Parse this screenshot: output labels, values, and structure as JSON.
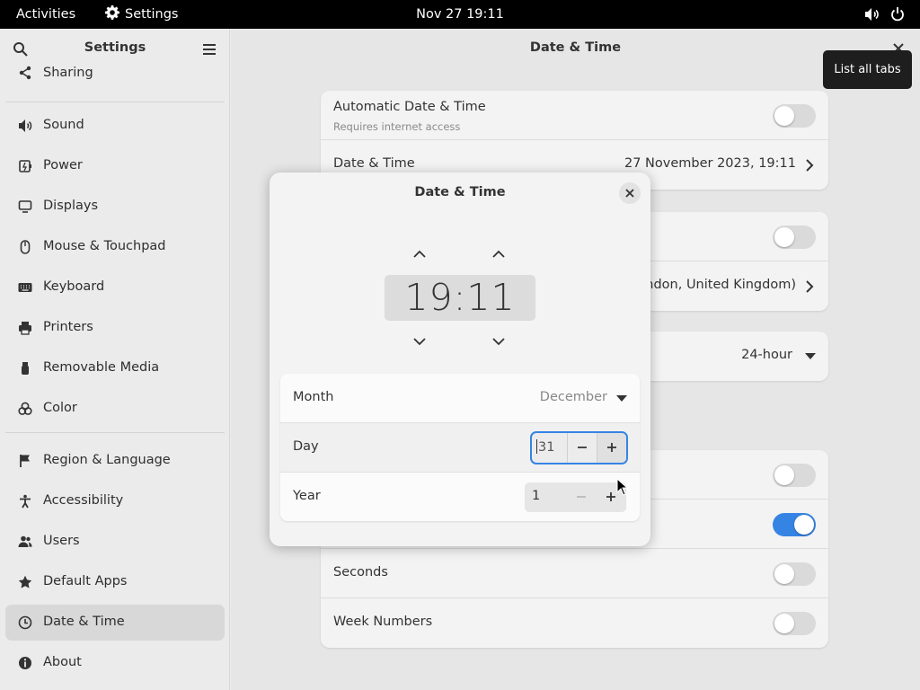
{
  "topbar": {
    "activities": "Activities",
    "app_name": "Settings",
    "clock": "Nov 27  19:11"
  },
  "sidebar": {
    "title": "Settings",
    "items": [
      {
        "label": "Sharing",
        "icon": "share-icon"
      },
      {
        "label": "Sound",
        "icon": "speaker-icon"
      },
      {
        "label": "Power",
        "icon": "battery-icon"
      },
      {
        "label": "Displays",
        "icon": "display-icon"
      },
      {
        "label": "Mouse & Touchpad",
        "icon": "mouse-icon"
      },
      {
        "label": "Keyboard",
        "icon": "keyboard-icon"
      },
      {
        "label": "Printers",
        "icon": "printer-icon"
      },
      {
        "label": "Removable Media",
        "icon": "usb-icon"
      },
      {
        "label": "Color",
        "icon": "color-icon"
      },
      {
        "label": "Region & Language",
        "icon": "flag-icon"
      },
      {
        "label": "Accessibility",
        "icon": "accessibility-icon"
      },
      {
        "label": "Users",
        "icon": "users-icon"
      },
      {
        "label": "Default Apps",
        "icon": "star-icon"
      },
      {
        "label": "Date & Time",
        "icon": "clock-icon",
        "active": true
      },
      {
        "label": "About",
        "icon": "info-icon"
      }
    ]
  },
  "main": {
    "title": "Date & Time",
    "auto_datetime": {
      "label": "Automatic Date & Time",
      "sublabel": "Requires internet access",
      "enabled": false
    },
    "datetime": {
      "label": "Date & Time",
      "value": "27 November 2023, 19:11"
    },
    "timezone_value": "London, United Kingdom)",
    "time_format_value": "24-hour",
    "seconds": {
      "label": "Seconds",
      "enabled": false
    },
    "week_numbers": {
      "label": "Week Numbers",
      "enabled": false
    }
  },
  "tooltip": "List all tabs",
  "dialog": {
    "title": "Date & Time",
    "time": "19:11",
    "month": {
      "label": "Month",
      "value": "December"
    },
    "day": {
      "label": "Day",
      "value": "31"
    },
    "year": {
      "label": "Year",
      "value": "1"
    }
  },
  "colors": {
    "accent": "#3584e4",
    "topbar": "#000000"
  }
}
